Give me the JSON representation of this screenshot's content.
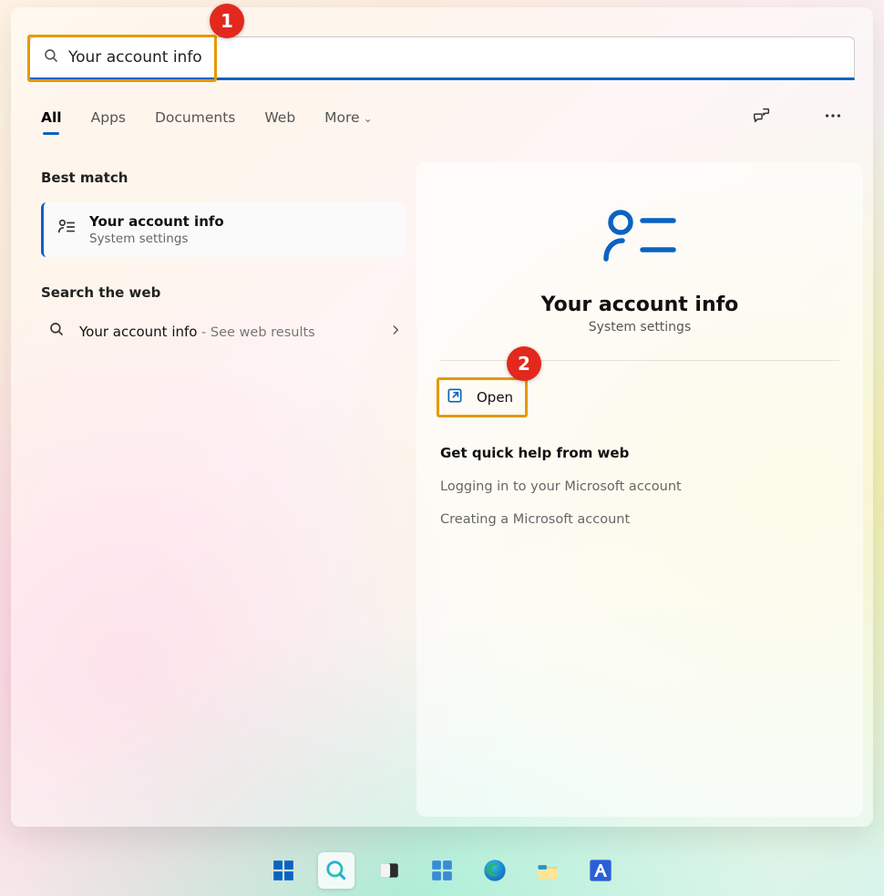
{
  "search": {
    "query": "Your account info"
  },
  "tabs": {
    "items": [
      "All",
      "Apps",
      "Documents",
      "Web",
      "More"
    ],
    "active_index": 0
  },
  "left": {
    "best_match_label": "Best match",
    "best_match": {
      "title": "Your account info",
      "subtitle": "System settings"
    },
    "search_web_label": "Search the web",
    "web_result": {
      "main": "Your account info",
      "suffix": " - See web results"
    }
  },
  "detail": {
    "title": "Your account info",
    "subtitle": "System settings",
    "open_label": "Open",
    "quick_help_title": "Get quick help from web",
    "quick_links": [
      "Logging in to your Microsoft account",
      "Creating a Microsoft account"
    ]
  },
  "annotations": {
    "badge1": "1",
    "badge2": "2"
  },
  "taskbar": {
    "items": [
      {
        "name": "start"
      },
      {
        "name": "search",
        "active": true
      },
      {
        "name": "task-view"
      },
      {
        "name": "widgets"
      },
      {
        "name": "edge"
      },
      {
        "name": "file-explorer"
      },
      {
        "name": "app-m"
      }
    ]
  }
}
